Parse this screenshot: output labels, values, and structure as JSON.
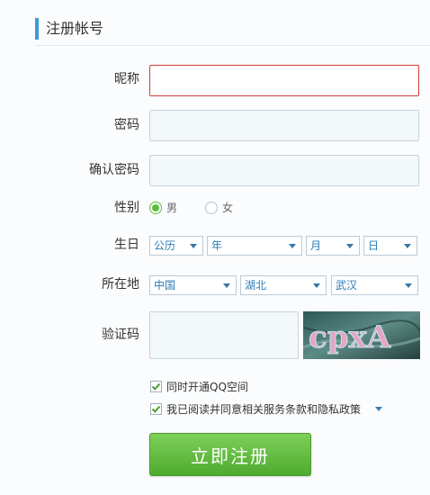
{
  "header": {
    "title": "注册帐号"
  },
  "form": {
    "nickname": {
      "label": "昵称",
      "value": ""
    },
    "password": {
      "label": "密码",
      "value": ""
    },
    "confirm_password": {
      "label": "确认密码",
      "value": ""
    },
    "gender": {
      "label": "性别",
      "options": [
        {
          "label": "男",
          "checked": true
        },
        {
          "label": "女",
          "checked": false
        }
      ]
    },
    "birthday": {
      "label": "生日",
      "calendar": "公历",
      "year": "年",
      "month": "月",
      "day": "日"
    },
    "location": {
      "label": "所在地",
      "country": "中国",
      "province": "湖北",
      "city": "武汉"
    },
    "captcha": {
      "label": "验证码",
      "value": "",
      "image_text": "cpxA"
    },
    "options": {
      "qzone": {
        "label": "同时开通QQ空间",
        "checked": true
      },
      "agreement": {
        "label": "我已阅读并同意相关服务条款和隐私政策",
        "checked": true
      }
    },
    "submit_label": "立即注册"
  },
  "colors": {
    "accent": "#3a9bd8",
    "error_border": "#d23b3b",
    "radio_checked": "#5bbd3d",
    "submit_green": "#5cb83a"
  }
}
